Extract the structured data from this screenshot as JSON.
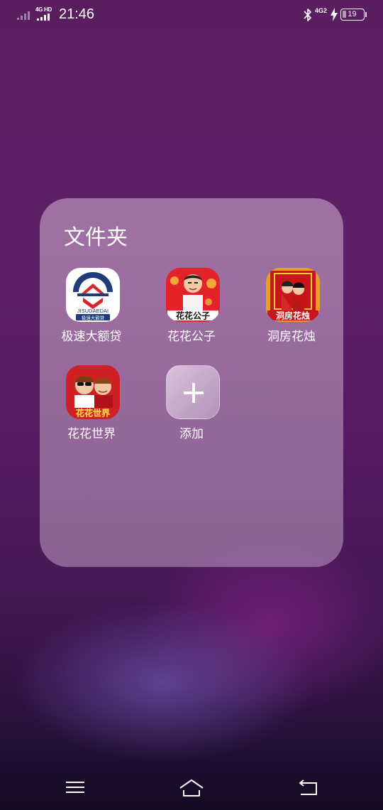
{
  "status_bar": {
    "network_label": "4G HD",
    "time": "21:46",
    "network2_label": "4G2",
    "battery_level": "19",
    "icons": [
      "signal-icon",
      "bluetooth-icon",
      "charging-bolt-icon",
      "battery-icon"
    ]
  },
  "folder": {
    "title": "文件夹",
    "apps": [
      {
        "name": "极速大额贷",
        "icon": "jisudaedai-app-icon",
        "icon_text": "JISUDAEDAI",
        "icon_subtext": "极速大额贷"
      },
      {
        "name": "花花公子",
        "icon": "huahua-gongzi-app-icon",
        "icon_text": "花花公子"
      },
      {
        "name": "洞房花烛",
        "icon": "dongfang-huazhu-app-icon",
        "icon_text": "洞房花烛"
      },
      {
        "name": "花花世界",
        "icon": "huahua-shijie-app-icon",
        "icon_text": "花花世界"
      },
      {
        "name": "添加",
        "icon": "add-plus-icon"
      }
    ]
  },
  "nav_bar": {
    "buttons": [
      "menu-icon",
      "home-icon",
      "back-icon"
    ]
  },
  "colors": {
    "wallpaper_top": "#5a1d60",
    "wallpaper_bottom": "#140a22",
    "folder_bg": "#c8aacd"
  }
}
